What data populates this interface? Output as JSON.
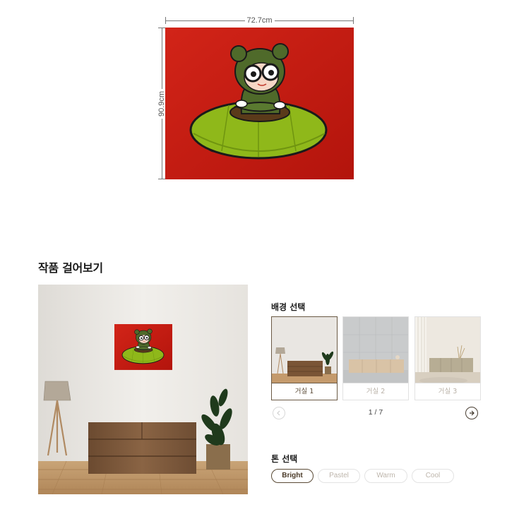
{
  "artwork": {
    "width_label": "72.7cm",
    "height_label": "90.9cm",
    "colors": {
      "background": "#c4180f",
      "ufo": "#8fb81a",
      "ufo_lights": "#f0e01a",
      "character": "#4f6a2a"
    }
  },
  "section_title": "작품 걸어보기",
  "background_select": {
    "title": "배경 선택",
    "thumbnails": [
      {
        "label": "거실 1",
        "active": true
      },
      {
        "label": "거실 2",
        "active": false
      },
      {
        "label": "거실 3",
        "active": false
      }
    ],
    "pager": "1 / 7",
    "prev_icon": "chevron-left-icon",
    "next_icon": "chevron-right-icon"
  },
  "tone_select": {
    "title": "톤 선택",
    "options": [
      {
        "label": "Bright",
        "active": true
      },
      {
        "label": "Pastel",
        "active": false
      },
      {
        "label": "Warm",
        "active": false
      },
      {
        "label": "Cool",
        "active": false
      }
    ]
  },
  "accent_color": "#5a4a36"
}
